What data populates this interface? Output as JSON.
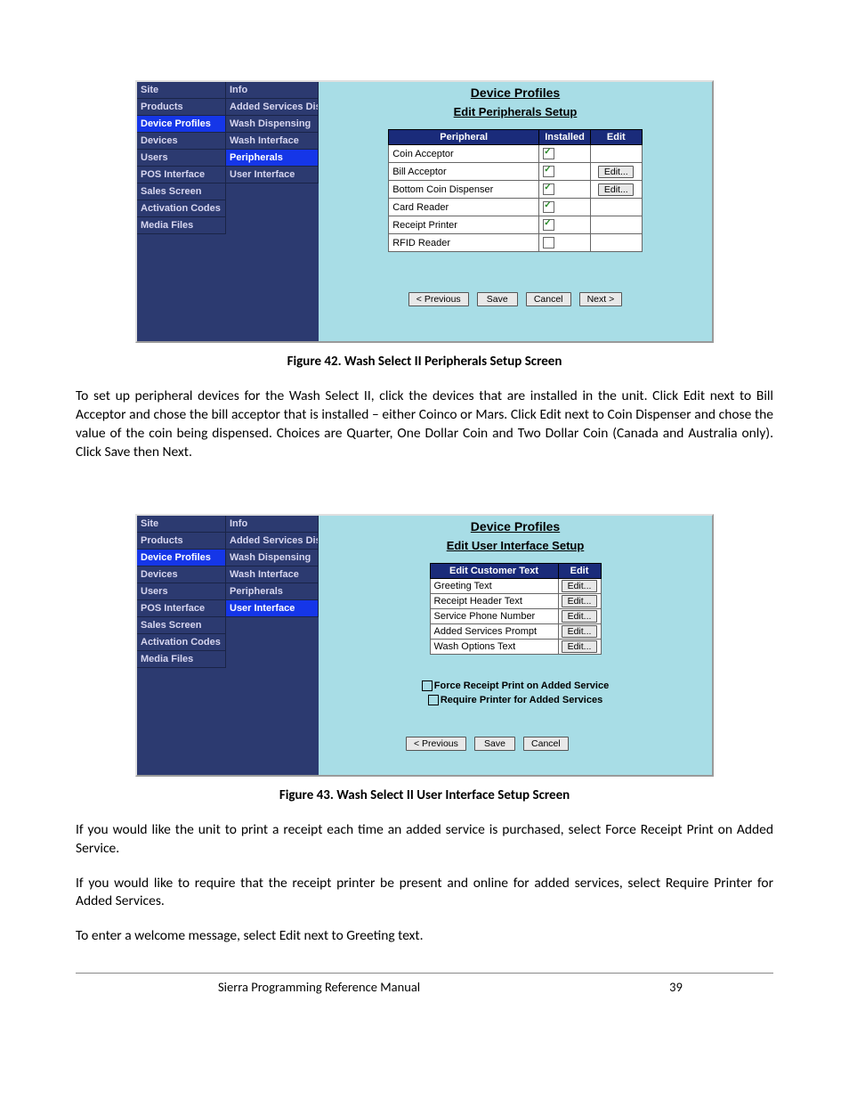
{
  "figure42": {
    "caption": "Figure 42. Wash Select II Peripherals Setup Screen",
    "nav1": [
      {
        "label": "Site",
        "selected": false
      },
      {
        "label": "Products",
        "selected": false
      },
      {
        "label": "Device Profiles",
        "selected": true
      },
      {
        "label": "Devices",
        "selected": false
      },
      {
        "label": "Users",
        "selected": false
      },
      {
        "label": "POS Interface",
        "selected": false
      },
      {
        "label": "Sales Screen",
        "selected": false
      },
      {
        "label": "Activation Codes",
        "selected": false
      },
      {
        "label": "Media Files",
        "selected": false
      }
    ],
    "nav2": [
      {
        "label": "Info",
        "selected": false
      },
      {
        "label": "Added Services Dispensing",
        "selected": false
      },
      {
        "label": "Wash Dispensing",
        "selected": false
      },
      {
        "label": "Wash Interface",
        "selected": false
      },
      {
        "label": "Peripherals",
        "selected": true
      },
      {
        "label": "User Interface",
        "selected": false
      }
    ],
    "title": "Device Profiles",
    "subtitle": "Edit Peripherals Setup",
    "headers": {
      "peripheral": "Peripheral",
      "installed": "Installed",
      "edit": "Edit"
    },
    "rows": [
      {
        "name": "Coin Acceptor",
        "installed": true,
        "edit": ""
      },
      {
        "name": "Bill Acceptor",
        "installed": true,
        "edit": "Edit..."
      },
      {
        "name": "Bottom Coin Dispenser",
        "installed": true,
        "edit": "Edit..."
      },
      {
        "name": "Card Reader",
        "installed": true,
        "edit": ""
      },
      {
        "name": "Receipt Printer",
        "installed": true,
        "edit": ""
      },
      {
        "name": "RFID Reader",
        "installed": false,
        "edit": ""
      }
    ],
    "buttons": {
      "prev": "< Previous",
      "save": "Save",
      "cancel": "Cancel",
      "next": "Next >"
    }
  },
  "para1": "To set up peripheral devices for the Wash Select II, click the devices that are installed in the unit. Click Edit next to Bill Acceptor and chose the bill acceptor that is installed – either Coinco or Mars. Click Edit next to Coin Dispenser and chose the value of the coin being dispensed. Choices are Quarter, One Dollar Coin and Two Dollar Coin (Canada and Australia only). Click Save then Next.",
  "figure43": {
    "caption": "Figure 43. Wash Select II User Interface Setup Screen",
    "nav1": [
      {
        "label": "Site",
        "selected": false
      },
      {
        "label": "Products",
        "selected": false
      },
      {
        "label": "Device Profiles",
        "selected": true
      },
      {
        "label": "Devices",
        "selected": false
      },
      {
        "label": "Users",
        "selected": false
      },
      {
        "label": "POS Interface",
        "selected": false
      },
      {
        "label": "Sales Screen",
        "selected": false
      },
      {
        "label": "Activation Codes",
        "selected": false
      },
      {
        "label": "Media Files",
        "selected": false
      }
    ],
    "nav2": [
      {
        "label": "Info",
        "selected": false
      },
      {
        "label": "Added Services Dispensing",
        "selected": false
      },
      {
        "label": "Wash Dispensing",
        "selected": false
      },
      {
        "label": "Wash Interface",
        "selected": false
      },
      {
        "label": "Peripherals",
        "selected": false
      },
      {
        "label": "User Interface",
        "selected": true
      }
    ],
    "title": "Device Profiles",
    "subtitle": "Edit User Interface Setup",
    "headers": {
      "text": "Edit Customer Text",
      "edit": "Edit"
    },
    "rows": [
      {
        "name": "Greeting Text",
        "edit": "Edit..."
      },
      {
        "name": "Receipt Header Text",
        "edit": "Edit..."
      },
      {
        "name": "Service Phone Number",
        "edit": "Edit..."
      },
      {
        "name": "Added Services Prompt",
        "edit": "Edit..."
      },
      {
        "name": "Wash Options Text",
        "edit": "Edit..."
      }
    ],
    "options": [
      {
        "label": "Force Receipt Print on Added Service",
        "checked": false
      },
      {
        "label": "Require Printer for Added Services",
        "checked": false
      }
    ],
    "buttons": {
      "prev": "< Previous",
      "save": "Save",
      "cancel": "Cancel"
    }
  },
  "para2": "If you would like the unit to print a receipt each time an added service is purchased, select Force Receipt Print on Added Service.",
  "para3": "If you would like to require that the receipt printer be present and online for added services, select Require Printer for Added Services.",
  "para4": "To enter a welcome message, select Edit next to Greeting text.",
  "footer": {
    "title": "Sierra Programming Reference Manual",
    "page": "39"
  }
}
